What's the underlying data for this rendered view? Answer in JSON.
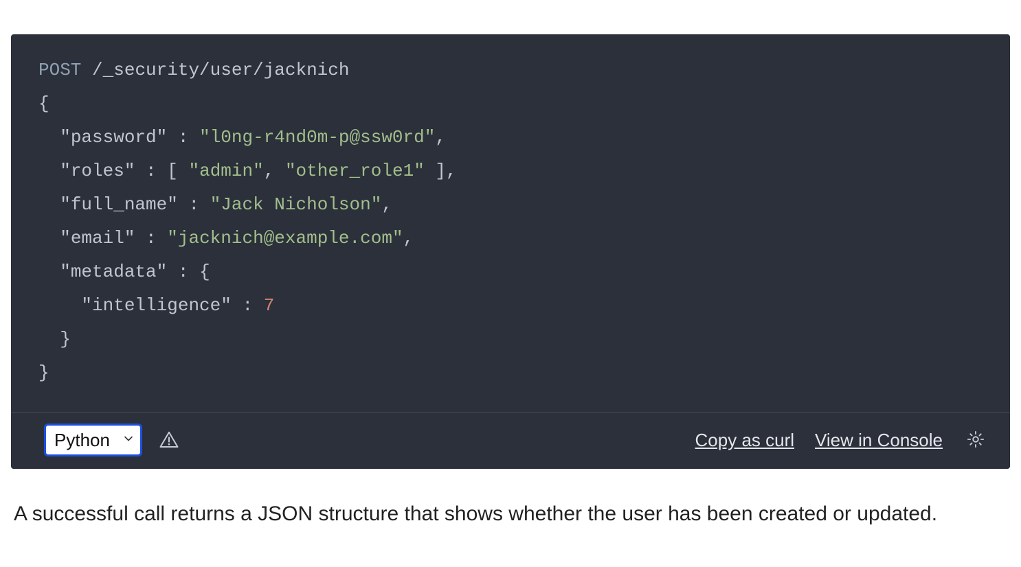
{
  "code": {
    "method": "POST",
    "path": "/_security/user/jacknich",
    "body": {
      "password": "l0ng-r4nd0m-p@ssw0rd",
      "roles": [
        "admin",
        "other_role1"
      ],
      "full_name": "Jack Nicholson",
      "email": "jacknich@example.com",
      "metadata": {
        "intelligence": 7
      }
    }
  },
  "toolbar": {
    "language_selected": "Python",
    "copy_label": "Copy as curl",
    "view_label": "View in Console"
  },
  "body_text": "A successful call returns a JSON structure that shows whether the user has been created or updated."
}
